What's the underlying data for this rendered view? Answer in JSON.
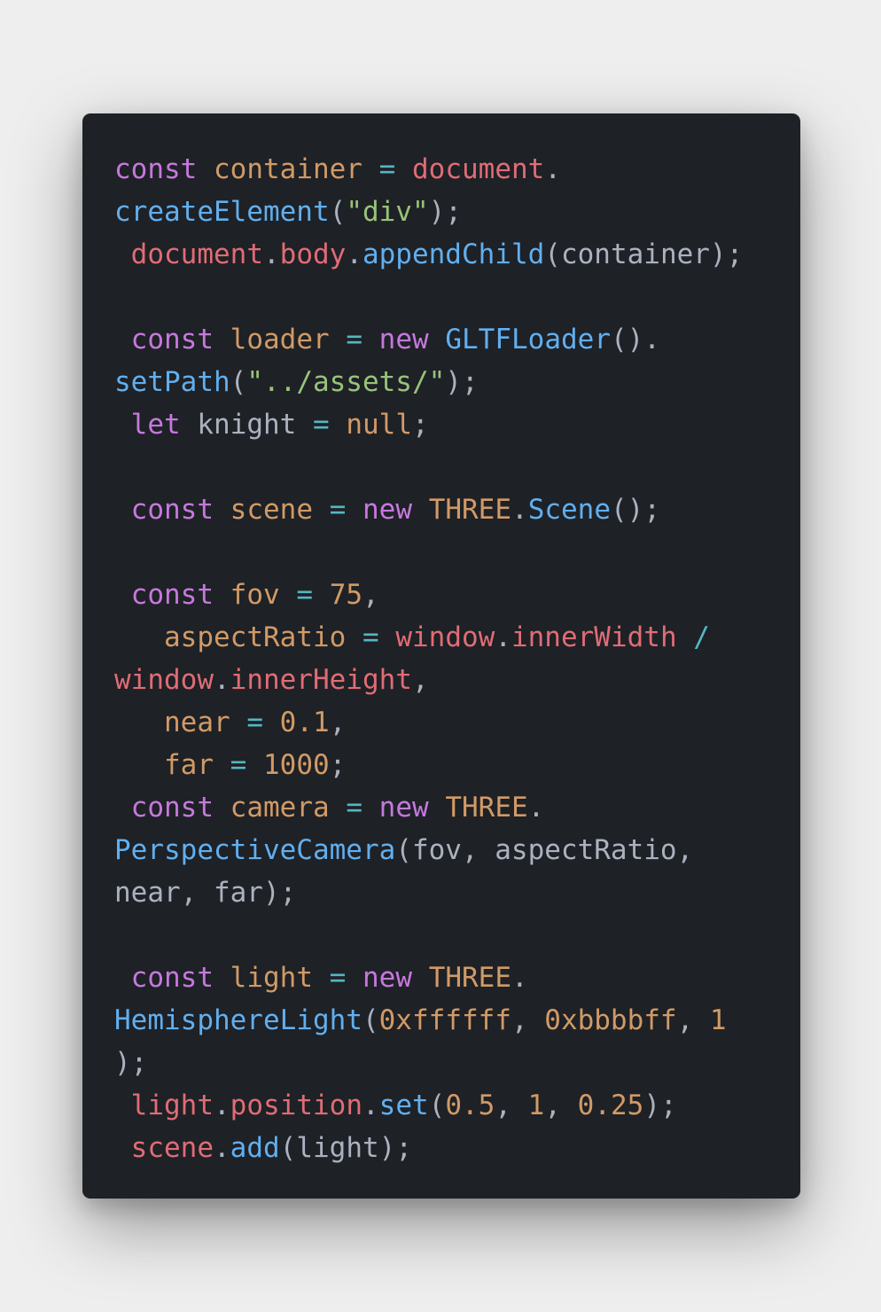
{
  "code": {
    "lines": [
      [
        {
          "t": "kw",
          "v": "const"
        },
        {
          "t": "plain",
          "v": " "
        },
        {
          "t": "var",
          "v": "container"
        },
        {
          "t": "plain",
          "v": " "
        },
        {
          "t": "op",
          "v": "="
        },
        {
          "t": "plain",
          "v": " "
        },
        {
          "t": "obj",
          "v": "document"
        },
        {
          "t": "punc",
          "v": "."
        }
      ],
      [
        {
          "t": "fn",
          "v": "createElement"
        },
        {
          "t": "punc",
          "v": "("
        },
        {
          "t": "str",
          "v": "\"div\""
        },
        {
          "t": "punc",
          "v": ");"
        }
      ],
      [
        {
          "t": "plain",
          "v": " "
        },
        {
          "t": "obj",
          "v": "document"
        },
        {
          "t": "punc",
          "v": "."
        },
        {
          "t": "obj",
          "v": "body"
        },
        {
          "t": "punc",
          "v": "."
        },
        {
          "t": "fn",
          "v": "appendChild"
        },
        {
          "t": "punc",
          "v": "(container);"
        }
      ],
      [],
      [
        {
          "t": "plain",
          "v": " "
        },
        {
          "t": "kw",
          "v": "const"
        },
        {
          "t": "plain",
          "v": " "
        },
        {
          "t": "var",
          "v": "loader"
        },
        {
          "t": "plain",
          "v": " "
        },
        {
          "t": "op",
          "v": "="
        },
        {
          "t": "plain",
          "v": " "
        },
        {
          "t": "kw",
          "v": "new"
        },
        {
          "t": "plain",
          "v": " "
        },
        {
          "t": "fn",
          "v": "GLTFLoader"
        },
        {
          "t": "punc",
          "v": "()."
        }
      ],
      [
        {
          "t": "fn",
          "v": "setPath"
        },
        {
          "t": "punc",
          "v": "("
        },
        {
          "t": "str",
          "v": "\"../assets/\""
        },
        {
          "t": "punc",
          "v": ");"
        }
      ],
      [
        {
          "t": "plain",
          "v": " "
        },
        {
          "t": "kw",
          "v": "let"
        },
        {
          "t": "plain",
          "v": " knight "
        },
        {
          "t": "op",
          "v": "="
        },
        {
          "t": "plain",
          "v": " "
        },
        {
          "t": "num",
          "v": "null"
        },
        {
          "t": "punc",
          "v": ";"
        }
      ],
      [],
      [
        {
          "t": "plain",
          "v": " "
        },
        {
          "t": "kw",
          "v": "const"
        },
        {
          "t": "plain",
          "v": " "
        },
        {
          "t": "var",
          "v": "scene"
        },
        {
          "t": "plain",
          "v": " "
        },
        {
          "t": "op",
          "v": "="
        },
        {
          "t": "plain",
          "v": " "
        },
        {
          "t": "kw",
          "v": "new"
        },
        {
          "t": "plain",
          "v": " "
        },
        {
          "t": "var",
          "v": "THREE"
        },
        {
          "t": "punc",
          "v": "."
        },
        {
          "t": "fn",
          "v": "Scene"
        },
        {
          "t": "punc",
          "v": "();"
        }
      ],
      [],
      [
        {
          "t": "plain",
          "v": " "
        },
        {
          "t": "kw",
          "v": "const"
        },
        {
          "t": "plain",
          "v": " "
        },
        {
          "t": "var",
          "v": "fov"
        },
        {
          "t": "plain",
          "v": " "
        },
        {
          "t": "op",
          "v": "="
        },
        {
          "t": "plain",
          "v": " "
        },
        {
          "t": "num",
          "v": "75"
        },
        {
          "t": "punc",
          "v": ","
        }
      ],
      [
        {
          "t": "plain",
          "v": "   "
        },
        {
          "t": "var",
          "v": "aspectRatio"
        },
        {
          "t": "plain",
          "v": " "
        },
        {
          "t": "op",
          "v": "="
        },
        {
          "t": "plain",
          "v": " "
        },
        {
          "t": "obj",
          "v": "window"
        },
        {
          "t": "punc",
          "v": "."
        },
        {
          "t": "obj",
          "v": "innerWidth"
        },
        {
          "t": "plain",
          "v": " "
        },
        {
          "t": "op",
          "v": "/"
        }
      ],
      [
        {
          "t": "obj",
          "v": "window"
        },
        {
          "t": "punc",
          "v": "."
        },
        {
          "t": "obj",
          "v": "innerHeight"
        },
        {
          "t": "punc",
          "v": ","
        }
      ],
      [
        {
          "t": "plain",
          "v": "   "
        },
        {
          "t": "var",
          "v": "near"
        },
        {
          "t": "plain",
          "v": " "
        },
        {
          "t": "op",
          "v": "="
        },
        {
          "t": "plain",
          "v": " "
        },
        {
          "t": "num",
          "v": "0.1"
        },
        {
          "t": "punc",
          "v": ","
        }
      ],
      [
        {
          "t": "plain",
          "v": "   "
        },
        {
          "t": "var",
          "v": "far"
        },
        {
          "t": "plain",
          "v": " "
        },
        {
          "t": "op",
          "v": "="
        },
        {
          "t": "plain",
          "v": " "
        },
        {
          "t": "num",
          "v": "1000"
        },
        {
          "t": "punc",
          "v": ";"
        }
      ],
      [
        {
          "t": "plain",
          "v": " "
        },
        {
          "t": "kw",
          "v": "const"
        },
        {
          "t": "plain",
          "v": " "
        },
        {
          "t": "var",
          "v": "camera"
        },
        {
          "t": "plain",
          "v": " "
        },
        {
          "t": "op",
          "v": "="
        },
        {
          "t": "plain",
          "v": " "
        },
        {
          "t": "kw",
          "v": "new"
        },
        {
          "t": "plain",
          "v": " "
        },
        {
          "t": "var",
          "v": "THREE"
        },
        {
          "t": "punc",
          "v": "."
        }
      ],
      [
        {
          "t": "fn",
          "v": "PerspectiveCamera"
        },
        {
          "t": "punc",
          "v": "(fov, aspectRatio,"
        }
      ],
      [
        {
          "t": "punc",
          "v": "near, far);"
        }
      ],
      [],
      [
        {
          "t": "plain",
          "v": " "
        },
        {
          "t": "kw",
          "v": "const"
        },
        {
          "t": "plain",
          "v": " "
        },
        {
          "t": "var",
          "v": "light"
        },
        {
          "t": "plain",
          "v": " "
        },
        {
          "t": "op",
          "v": "="
        },
        {
          "t": "plain",
          "v": " "
        },
        {
          "t": "kw",
          "v": "new"
        },
        {
          "t": "plain",
          "v": " "
        },
        {
          "t": "var",
          "v": "THREE"
        },
        {
          "t": "punc",
          "v": "."
        }
      ],
      [
        {
          "t": "fn",
          "v": "HemisphereLight"
        },
        {
          "t": "punc",
          "v": "("
        },
        {
          "t": "num",
          "v": "0xffffff"
        },
        {
          "t": "punc",
          "v": ", "
        },
        {
          "t": "num",
          "v": "0xbbbbff"
        },
        {
          "t": "punc",
          "v": ", "
        },
        {
          "t": "num",
          "v": "1"
        }
      ],
      [
        {
          "t": "punc",
          "v": ");"
        }
      ],
      [
        {
          "t": "plain",
          "v": " "
        },
        {
          "t": "obj",
          "v": "light"
        },
        {
          "t": "punc",
          "v": "."
        },
        {
          "t": "obj",
          "v": "position"
        },
        {
          "t": "punc",
          "v": "."
        },
        {
          "t": "fn",
          "v": "set"
        },
        {
          "t": "punc",
          "v": "("
        },
        {
          "t": "num",
          "v": "0.5"
        },
        {
          "t": "punc",
          "v": ", "
        },
        {
          "t": "num",
          "v": "1"
        },
        {
          "t": "punc",
          "v": ", "
        },
        {
          "t": "num",
          "v": "0.25"
        },
        {
          "t": "punc",
          "v": ");"
        }
      ],
      [
        {
          "t": "plain",
          "v": " "
        },
        {
          "t": "obj",
          "v": "scene"
        },
        {
          "t": "punc",
          "v": "."
        },
        {
          "t": "fn",
          "v": "add"
        },
        {
          "t": "punc",
          "v": "(light);"
        }
      ]
    ]
  },
  "colors": {
    "page_background": "#eeeeee",
    "editor_background": "#1e2126",
    "keyword": "#c678dd",
    "variable": "#d19a66",
    "object": "#e06c75",
    "function": "#61afef",
    "string": "#98c379",
    "operator": "#56b6c2",
    "plain": "#abb2bf"
  }
}
